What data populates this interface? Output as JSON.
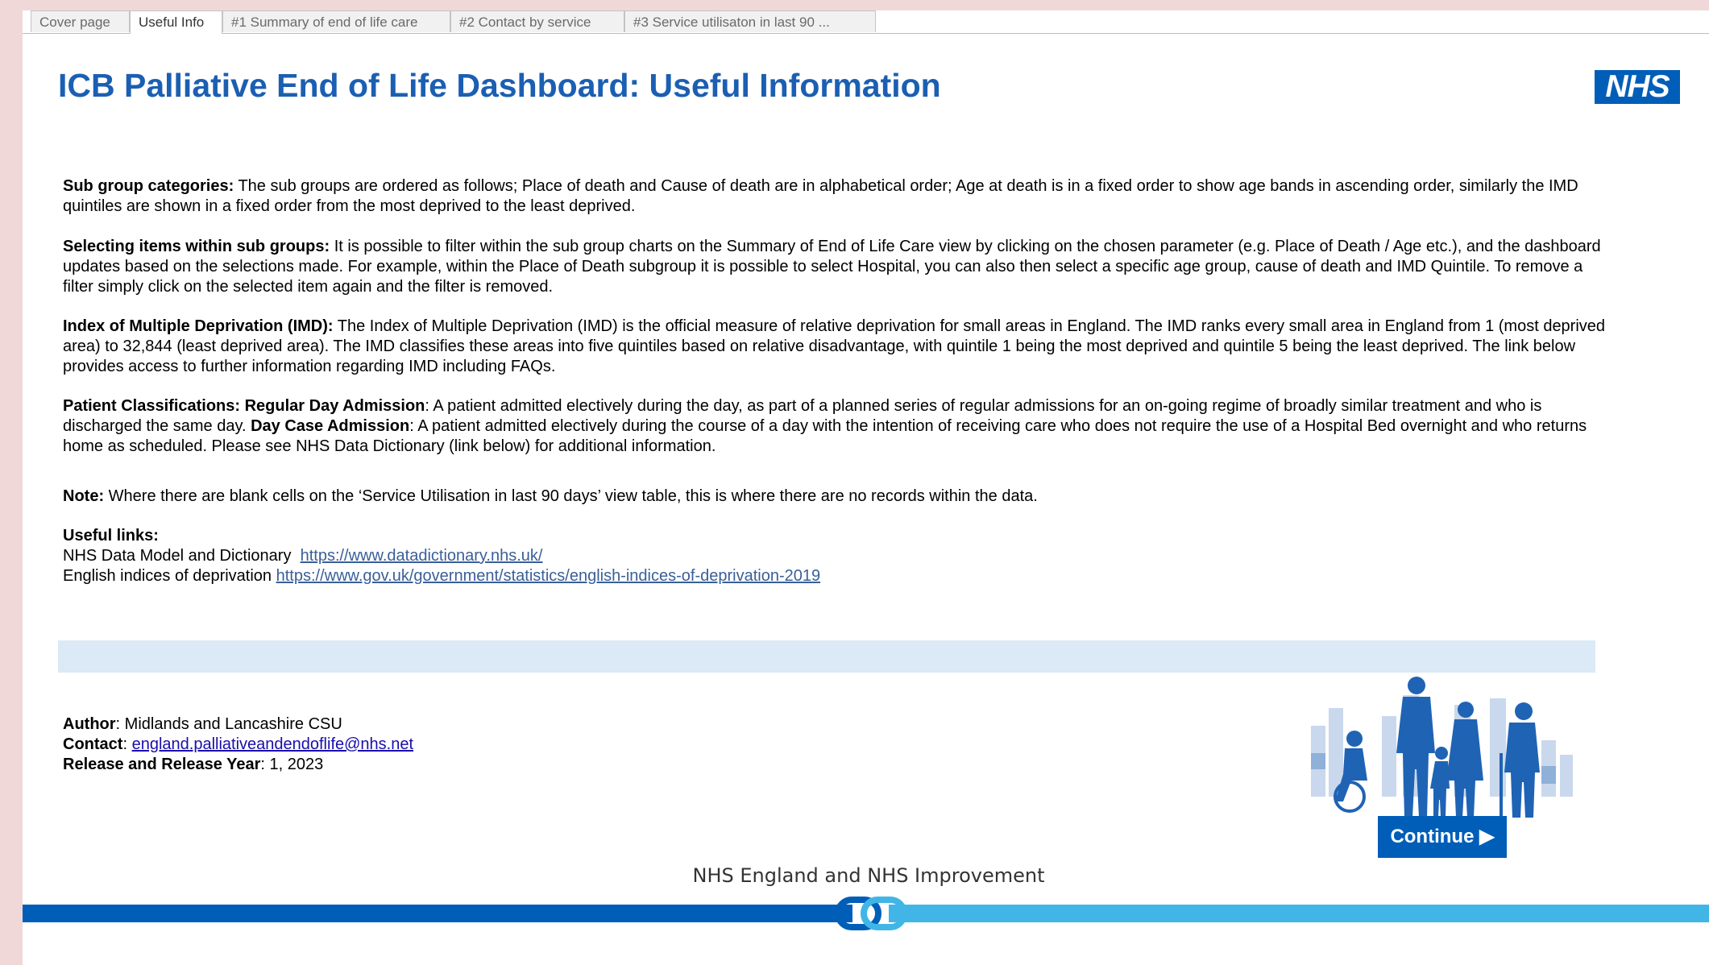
{
  "tabs": [
    {
      "label": "Cover page",
      "active": false
    },
    {
      "label": "Useful Info",
      "active": true
    },
    {
      "label": "#1 Summary of end of life care",
      "active": false
    },
    {
      "label": "#2 Contact by service",
      "active": false
    },
    {
      "label": "#3 Service utilisaton in last 90 ...",
      "active": false
    }
  ],
  "title": "ICB Palliative End of Life Dashboard: Useful Information",
  "logo_text": "NHS",
  "sections": {
    "subgroups": {
      "heading": "Sub group categories:",
      "text": " The sub groups are ordered as follows; Place of death and Cause of death are in alphabetical order; Age at death is in a fixed order to show age bands in ascending order, similarly the IMD quintiles are shown in a fixed order from the most deprived to the least deprived."
    },
    "selecting": {
      "heading": "Selecting items within sub groups:",
      "text": " It is possible to filter within the sub group charts on the Summary of End of Life Care view by clicking on the chosen parameter (e.g. Place of Death / Age etc.), and the dashboard updates based on the selections made.  For example, within the Place of Death subgroup it is possible to select Hospital, you can also then select a specific age group, cause of death and IMD Quintile. To remove a filter simply click on the selected item again and the filter is removed."
    },
    "imd": {
      "heading": "Index of Multiple Deprivation (IMD):",
      "text": " The Index of Multiple Deprivation (IMD) is the official measure of relative deprivation for small areas in England. The IMD ranks every small area in England from 1 (most deprived area) to 32,844 (least deprived area). The IMD classifies these areas into five quintiles based on relative disadvantage, with quintile 1 being the most deprived and quintile 5 being the least deprived. The link below provides access to further information regarding IMD including FAQs."
    },
    "patient": {
      "heading": "Patient Classifications: Regular Day Admission",
      "text1": ": A patient admitted electively during the day, as part of a planned series of regular admissions for an on-going regime of broadly similar treatment and who is discharged the same day. ",
      "heading2": "Day Case Admission",
      "text2": ": A patient admitted electively during the course of a day with the intention of receiving care who does not require the use of a Hospital Bed overnight and who returns home as scheduled. Please see NHS Data Dictionary (link below) for additional information."
    },
    "note": {
      "heading": "Note:",
      "text": " Where there are blank cells on the ‘Service Utilisation in last 90 days’ view table, this is where there are no records within the data."
    },
    "links": {
      "heading": "Useful links:",
      "items": [
        {
          "label": "NHS Data Model and Dictionary  ",
          "url": "https://www.datadictionary.nhs.uk/"
        },
        {
          "label": "English indices of deprivation ",
          "url": "https://www.gov.uk/government/statistics/english-indices-of-deprivation-2019"
        }
      ]
    }
  },
  "footer": {
    "author_label": "Author",
    "author_value": ": Midlands and Lancashire CSU",
    "contact_label": "Contact",
    "contact_sep": ": ",
    "contact_email": "england.palliativeandendoflife@nhs.net",
    "release_label": "Release and Release Year",
    "release_value": ": 1, 2023"
  },
  "continue_label": "Continue ▶",
  "org_name": "NHS England and NHS Improvement",
  "colors": {
    "nhs_blue": "#005eb8",
    "light_blue": "#41b6e6",
    "title_blue": "#1b5fb2",
    "band": "#dce9f6"
  }
}
